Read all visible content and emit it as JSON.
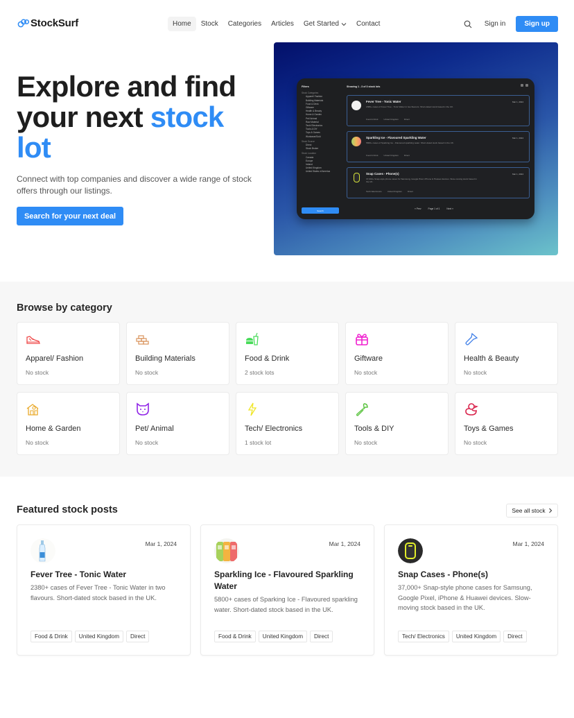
{
  "nav": {
    "logo": "StockSurf",
    "links": [
      {
        "label": "Home",
        "active": true
      },
      {
        "label": "Stock"
      },
      {
        "label": "Categories"
      },
      {
        "label": "Articles"
      },
      {
        "label": "Get Started",
        "has_dropdown": true
      },
      {
        "label": "Contact"
      }
    ],
    "search_icon": "search-icon",
    "signin": "Sign in",
    "signup": "Sign up"
  },
  "hero": {
    "title_line1": "Explore and find",
    "title_line2": "your next ",
    "title_accent1": "stock",
    "title_accent2": "lot",
    "subtitle": "Connect with top companies and discover a wide range of stock offers through our listings.",
    "cta": "Search for your next deal",
    "preview": {
      "filters_title": "Filters",
      "groups": [
        {
          "label": "Stock Categories",
          "items": [
            "Apparel/ Fashion",
            "Building Materials",
            "Food & Drink",
            "Giftware",
            "Health & Beauty",
            "Home & Garden",
            "Pet/ Animal",
            "Raw Material",
            "Tech/ Electronics",
            "Tools & DIY",
            "Toys & Games",
            "Workwear/Sold"
          ]
        },
        {
          "label": "Stock Source",
          "items": [
            "Direct",
            "Stock Broker"
          ]
        },
        {
          "label": "Stock Location",
          "items": [
            "Canada",
            "Europe",
            "Ireland",
            "United Kingdom",
            "United States of America"
          ]
        }
      ],
      "search_button": "Search",
      "showing": "Showing 1 - 3 of 3 stock lots",
      "cards": [
        {
          "title": "Fever Tree - Tonic Water",
          "desc": "2380+ cases of Fever Tree - Tonic Water in two flavours. Short-dated stock based in the UK.",
          "tags": [
            "Food & Drink",
            "United Kingdom",
            "Direct"
          ],
          "date": "Mar 1, 2024"
        },
        {
          "title": "Sparkling Ice - Flavoured Sparkling Water",
          "desc": "5800+ cases of Sparking Ice - Flavoured sparkling water. Short-dated stock based in the UK.",
          "tags": [
            "Food & Drink",
            "United Kingdom",
            "Direct"
          ],
          "date": "Mar 1, 2024"
        },
        {
          "title": "Snap Cases - Phone(s)",
          "desc": "37,000+ Snap-style phone cases for Samsung, Google Pixel, iPhone & Huawei devices. Slow-moving stock based in the UK.",
          "tags": [
            "Tech/ Electronics",
            "United Kingdom",
            "Direct"
          ],
          "date": "Mar 1, 2024"
        }
      ],
      "pager": {
        "prev": "« Prev",
        "page": "Page 1 of 1",
        "next": "Next »"
      }
    }
  },
  "categories": {
    "title": "Browse by category",
    "items": [
      {
        "name": "Apparel/ Fashion",
        "count": "No stock",
        "icon": "shoe-icon",
        "color": "#ef4b4b"
      },
      {
        "name": "Building Materials",
        "count": "No stock",
        "icon": "bricks-icon",
        "color": "#d9925a"
      },
      {
        "name": "Food & Drink",
        "count": "2 stock lots",
        "icon": "burger-drink-icon",
        "color": "#4bdc5c"
      },
      {
        "name": "Giftware",
        "count": "No stock",
        "icon": "gift-icon",
        "color": "#f01fcf"
      },
      {
        "name": "Health & Beauty",
        "count": "No stock",
        "icon": "torch-icon",
        "color": "#3f7fe8"
      },
      {
        "name": "Home & Garden",
        "count": "No stock",
        "icon": "house-icon",
        "color": "#e9a92a"
      },
      {
        "name": "Pet/ Animal",
        "count": "No stock",
        "icon": "dog-icon",
        "color": "#8f23e6"
      },
      {
        "name": "Tech/ Electronics",
        "count": "1 stock lot",
        "icon": "lightning-icon",
        "color": "#f0e629"
      },
      {
        "name": "Tools & DIY",
        "count": "No stock",
        "icon": "wrench-icon",
        "color": "#5cc441"
      },
      {
        "name": "Toys & Games",
        "count": "No stock",
        "icon": "duck-icon",
        "color": "#d9254d"
      }
    ]
  },
  "featured": {
    "title": "Featured stock posts",
    "see_all": "See all stock",
    "posts": [
      {
        "title": "Fever Tree - Tonic Water",
        "date": "Mar 1, 2024",
        "desc": "2380+ cases of Fever Tree - Tonic Water in two flavours. Short-dated stock based in the UK.",
        "tags": [
          "Food & Drink",
          "United Kingdom",
          "Direct"
        ]
      },
      {
        "title": "Sparkling Ice - Flavoured Sparkling Water",
        "date": "Mar 1, 2024",
        "desc": "5800+ cases of Sparking Ice - Flavoured sparkling water. Short-dated stock based in the UK.",
        "tags": [
          "Food & Drink",
          "United Kingdom",
          "Direct"
        ]
      },
      {
        "title": "Snap Cases - Phone(s)",
        "date": "Mar 1, 2024",
        "desc": "37,000+ Snap-style phone cases for Samsung, Google Pixel, iPhone & Huawei devices. Slow-moving stock based in the UK.",
        "tags": [
          "Tech/ Electronics",
          "United Kingdom",
          "Direct"
        ]
      }
    ]
  },
  "colors": {
    "accent": "#2f8cf5",
    "section_bg": "#f7f7f7"
  }
}
